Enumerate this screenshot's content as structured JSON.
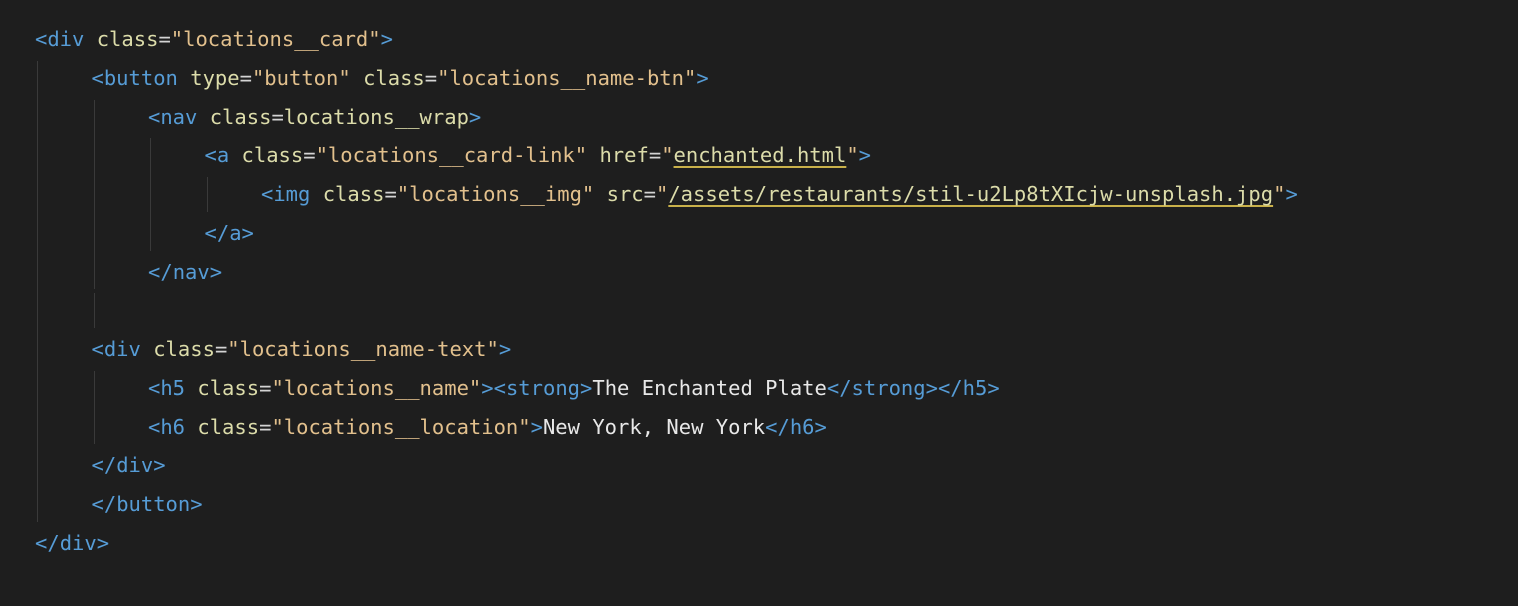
{
  "editor": {
    "language": "html",
    "theme": "dark",
    "colors": {
      "background": "#1e1e1e",
      "tag": "#569cd6",
      "bracket": "#808080",
      "attribute": "#dcdcaa",
      "string": "#e2c08d",
      "text": "#e8e8e8",
      "indent_guide": "#3a3a3a"
    },
    "lines": [
      {
        "indent": 0,
        "tokens": [
          {
            "k": "br",
            "t": "<"
          },
          {
            "k": "tag",
            "t": "div"
          },
          {
            "k": "sp",
            "t": " "
          },
          {
            "k": "attr",
            "t": "class"
          },
          {
            "k": "eq",
            "t": "="
          },
          {
            "k": "str",
            "t": "\"locations__card\""
          },
          {
            "k": "br",
            "t": ">"
          }
        ]
      },
      {
        "indent": 1,
        "tokens": [
          {
            "k": "br",
            "t": "<"
          },
          {
            "k": "tag",
            "t": "button"
          },
          {
            "k": "sp",
            "t": " "
          },
          {
            "k": "attr",
            "t": "type"
          },
          {
            "k": "eq",
            "t": "="
          },
          {
            "k": "str",
            "t": "\"button\""
          },
          {
            "k": "sp",
            "t": " "
          },
          {
            "k": "attr",
            "t": "class"
          },
          {
            "k": "eq",
            "t": "="
          },
          {
            "k": "str",
            "t": "\"locations__name-btn\""
          },
          {
            "k": "br",
            "t": ">"
          }
        ]
      },
      {
        "indent": 2,
        "tokens": [
          {
            "k": "br",
            "t": "<"
          },
          {
            "k": "tag",
            "t": "nav"
          },
          {
            "k": "sp",
            "t": " "
          },
          {
            "k": "attr",
            "t": "class"
          },
          {
            "k": "eq",
            "t": "="
          },
          {
            "k": "attr",
            "t": "locations__wrap"
          },
          {
            "k": "br",
            "t": ">"
          }
        ]
      },
      {
        "indent": 3,
        "tokens": [
          {
            "k": "br",
            "t": "<"
          },
          {
            "k": "tag",
            "t": "a"
          },
          {
            "k": "sp",
            "t": " "
          },
          {
            "k": "attr",
            "t": "class"
          },
          {
            "k": "eq",
            "t": "="
          },
          {
            "k": "str",
            "t": "\"locations__card-link\""
          },
          {
            "k": "sp",
            "t": " "
          },
          {
            "k": "attr",
            "t": "href"
          },
          {
            "k": "eq",
            "t": "="
          },
          {
            "k": "str",
            "t": "\""
          },
          {
            "k": "link",
            "t": "enchanted.html"
          },
          {
            "k": "str",
            "t": "\""
          },
          {
            "k": "br",
            "t": ">"
          }
        ]
      },
      {
        "indent": 4,
        "tokens": [
          {
            "k": "br",
            "t": "<"
          },
          {
            "k": "tag",
            "t": "img"
          },
          {
            "k": "sp",
            "t": " "
          },
          {
            "k": "attr",
            "t": "class"
          },
          {
            "k": "eq",
            "t": "="
          },
          {
            "k": "str",
            "t": "\"locations__img\""
          },
          {
            "k": "sp",
            "t": " "
          },
          {
            "k": "attr",
            "t": "src"
          },
          {
            "k": "eq",
            "t": "="
          },
          {
            "k": "str",
            "t": "\""
          },
          {
            "k": "link",
            "t": "/assets/restaurants/stil-u2Lp8tXIcjw-unsplash.jpg"
          },
          {
            "k": "str",
            "t": "\""
          },
          {
            "k": "br",
            "t": ">"
          }
        ]
      },
      {
        "indent": 3,
        "tokens": [
          {
            "k": "br",
            "t": "</"
          },
          {
            "k": "tag",
            "t": "a"
          },
          {
            "k": "br",
            "t": ">"
          }
        ]
      },
      {
        "indent": 2,
        "tokens": [
          {
            "k": "br",
            "t": "</"
          },
          {
            "k": "tag",
            "t": "nav"
          },
          {
            "k": "br",
            "t": ">"
          }
        ]
      },
      {
        "indent": 0,
        "tokens": []
      },
      {
        "indent": 1,
        "tokens": [
          {
            "k": "br",
            "t": "<"
          },
          {
            "k": "tag",
            "t": "div"
          },
          {
            "k": "sp",
            "t": " "
          },
          {
            "k": "attr",
            "t": "class"
          },
          {
            "k": "eq",
            "t": "="
          },
          {
            "k": "str",
            "t": "\"locations__name-text\""
          },
          {
            "k": "br",
            "t": ">"
          }
        ]
      },
      {
        "indent": 2,
        "tokens": [
          {
            "k": "br",
            "t": "<"
          },
          {
            "k": "tag",
            "t": "h5"
          },
          {
            "k": "sp",
            "t": " "
          },
          {
            "k": "attr",
            "t": "class"
          },
          {
            "k": "eq",
            "t": "="
          },
          {
            "k": "str",
            "t": "\"locations__name\""
          },
          {
            "k": "br",
            "t": "><"
          },
          {
            "k": "tag",
            "t": "strong"
          },
          {
            "k": "br",
            "t": ">"
          },
          {
            "k": "text",
            "t": "The Enchanted Plate"
          },
          {
            "k": "br",
            "t": "</"
          },
          {
            "k": "tag",
            "t": "strong"
          },
          {
            "k": "br",
            "t": "></"
          },
          {
            "k": "tag",
            "t": "h5"
          },
          {
            "k": "br",
            "t": ">"
          }
        ]
      },
      {
        "indent": 2,
        "tokens": [
          {
            "k": "br",
            "t": "<"
          },
          {
            "k": "tag",
            "t": "h6"
          },
          {
            "k": "sp",
            "t": " "
          },
          {
            "k": "attr",
            "t": "class"
          },
          {
            "k": "eq",
            "t": "="
          },
          {
            "k": "str",
            "t": "\"locations__location\""
          },
          {
            "k": "br",
            "t": ">"
          },
          {
            "k": "text",
            "t": "New York, New York"
          },
          {
            "k": "br",
            "t": "</"
          },
          {
            "k": "tag",
            "t": "h6"
          },
          {
            "k": "br",
            "t": ">"
          }
        ]
      },
      {
        "indent": 1,
        "tokens": [
          {
            "k": "br",
            "t": "</"
          },
          {
            "k": "tag",
            "t": "div"
          },
          {
            "k": "br",
            "t": ">"
          }
        ]
      },
      {
        "indent": 1,
        "tokens": [
          {
            "k": "br",
            "t": "</"
          },
          {
            "k": "tag",
            "t": "button"
          },
          {
            "k": "br",
            "t": ">"
          }
        ]
      },
      {
        "indent": 0,
        "tokens": [
          {
            "k": "br",
            "t": "</"
          },
          {
            "k": "tag",
            "t": "div"
          },
          {
            "k": "br",
            "t": ">"
          }
        ]
      }
    ]
  }
}
